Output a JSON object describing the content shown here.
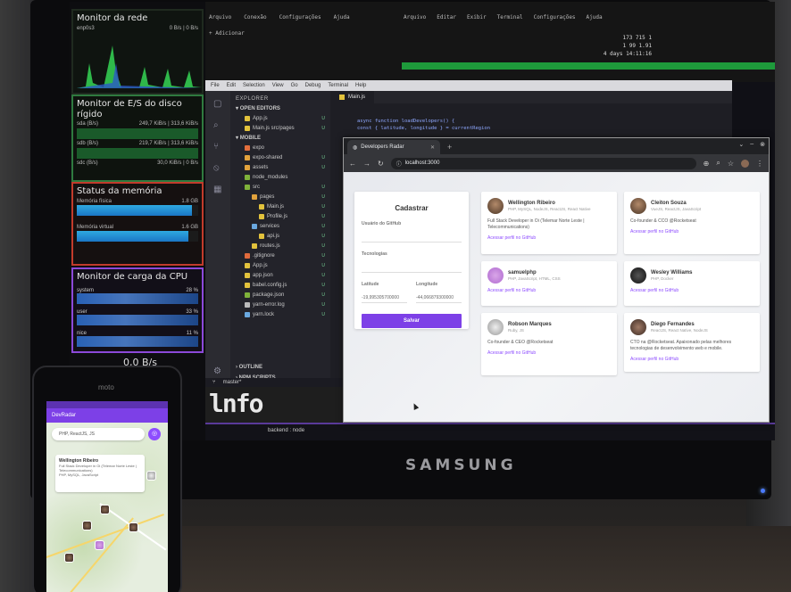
{
  "sysmon": {
    "net_title": "Monitor da rede",
    "net_sub": "enp0s3",
    "net_rate": "0 B/s | 0 B/s",
    "disk_title": "Monitor de E/S do disco rígido",
    "disk_rows": [
      {
        "name": "sda (B/s)",
        "value": "249,7 KiB/s | 313,6 KiB/s"
      },
      {
        "name": "sdb (B/s)",
        "value": "219,7 KiB/s | 313,6 KiB/s"
      },
      {
        "name": "sdc (B/s)",
        "value": "30,0 KiB/s | 0 B/s"
      }
    ],
    "mem_title": "Status da memória",
    "mem_physical_label": "Memória física",
    "mem_physical_value": "1.8 GB",
    "mem_physical_level": 0.95,
    "mem_virtual_label": "Memória virtual",
    "mem_virtual_value": "1.6 GB",
    "mem_virtual_level": 0.92,
    "cpu_title": "Monitor de carga da CPU",
    "cpu_rows": [
      {
        "name": "system",
        "value": "28 %"
      },
      {
        "name": "user",
        "value": "33 %"
      },
      {
        "name": "nice",
        "value": "11 %"
      }
    ],
    "cpu_footer": "0,0 B/s"
  },
  "terminal": {
    "menu": [
      "Arquivo",
      "Editar",
      "Exibir",
      "Terminal",
      "Configurações",
      "Ajuda"
    ],
    "tabs": [
      "Arquivo",
      "Conexão",
      "Configurações",
      "Ajuda"
    ],
    "add_label": "+ Adicionar",
    "stats": [
      "173  715     1",
      "1 99 1.91",
      "4 days  14:11:16"
    ]
  },
  "vscode": {
    "menu": [
      "File",
      "Edit",
      "Selection",
      "View",
      "Go",
      "Debug",
      "Terminal",
      "Help"
    ],
    "explorer_title": "EXPLORER",
    "open_editors": "OPEN EDITORS",
    "project": "MOBILE",
    "open_files": [
      {
        "name": "App.js",
        "badge": "U"
      },
      {
        "name": "Main.js  src/pages",
        "badge": "U"
      }
    ],
    "tree": [
      {
        "name": "expo",
        "badge": "",
        "color": "#e26e3c"
      },
      {
        "name": "expo-shared",
        "badge": "U",
        "color": "#e2a23c"
      },
      {
        "name": "assets",
        "badge": "U",
        "color": "#e2a23c"
      },
      {
        "name": "node_modules",
        "badge": "",
        "color": "#7fb23a"
      },
      {
        "name": "src",
        "badge": "U",
        "color": "#7fb23a"
      },
      {
        "name": "pages",
        "badge": "U",
        "color": "#e2a23c"
      },
      {
        "name": "Main.js",
        "badge": "U",
        "color": "#e2c23c"
      },
      {
        "name": "Profile.js",
        "badge": "U",
        "color": "#e2c23c"
      },
      {
        "name": "services",
        "badge": "U",
        "color": "#6aa8e0"
      },
      {
        "name": "api.js",
        "badge": "U",
        "color": "#e2c23c"
      },
      {
        "name": "routes.js",
        "badge": "U",
        "color": "#e2c23c"
      },
      {
        "name": ".gitignore",
        "badge": "U",
        "color": "#e06a3c"
      },
      {
        "name": "App.js",
        "badge": "U",
        "color": "#e2c23c"
      },
      {
        "name": "app.json",
        "badge": "U",
        "color": "#e2c23c"
      },
      {
        "name": "babel.config.js",
        "badge": "U",
        "color": "#e2c23c"
      },
      {
        "name": "package.json",
        "badge": "U",
        "color": "#7fb23a"
      },
      {
        "name": "yarn-error.log",
        "badge": "U",
        "color": "#bbbbbb"
      },
      {
        "name": "yarn.lock",
        "badge": "U",
        "color": "#6aa8e0"
      }
    ],
    "outline": "OUTLINE",
    "npm_scripts": "NPM SCRIPTS",
    "tab": "Main.js",
    "code": [
      "async function loadDevelopers() {",
      "  const { latitude, longitude } = currentRegion"
    ],
    "branch": "master*",
    "bottom_term": "backend : node"
  },
  "browser": {
    "tab_title": "Developers Radar",
    "url": "localhost:3000"
  },
  "devradar": {
    "form": {
      "title": "Cadastrar",
      "github_label": "Usuário do GitHub",
      "techs_label": "Tecnologias",
      "lat_label": "Latitude",
      "lat_value": "-19,995305700000",
      "lon_label": "Longitude",
      "lon_value": "-44,066879300000",
      "save": "Salvar"
    },
    "devs": [
      {
        "name": "Wellington Ribeiro",
        "techs": "PHP, MySQL, NodeJS, ReactJS, React Native",
        "bio": "Full Stack Developer in Oi (Telemar Norte Leste | Telecommunications)",
        "link": "Acessar perfil no GitHub"
      },
      {
        "name": "Cleiton Souza",
        "techs": "VueJS, ReactJS, JavaScript",
        "bio": "Co-founder & CCO @Rocketseat",
        "link": "Acessar perfil no GitHub"
      },
      {
        "name": "samuelphp",
        "techs": "PHP, JavaScript, HTML, CSS",
        "bio": "",
        "link": "Acessar perfil no GitHub"
      },
      {
        "name": "Wesley Williams",
        "techs": "PHP, Docker",
        "bio": "",
        "link": "Acessar perfil no GitHub"
      },
      {
        "name": "Robson Marques",
        "techs": "Ruby, JS",
        "bio": "Co-founder & CEO @Rocketseat",
        "link": "Acessar perfil no GitHub"
      },
      {
        "name": "Diego Fernandes",
        "techs": "ReactJS, React Native, NodeJS",
        "bio": "CTO na @Rocketseat. Apaixonado pelas melhores tecnologias de desenvolvimento web e mobile.",
        "link": "Acessar perfil no GitHub"
      }
    ]
  },
  "monitor_brand": "SAMSUNG",
  "phone": {
    "brand": "moto",
    "app_title": "DevRadar",
    "search_value": "PHP, ReactJS, JS",
    "callout_name": "Wellington Ribeiro",
    "callout_bio": "Full Stack Developer in Oi (Telemar Norte Leste | Telecommunications)",
    "callout_techs": "PHP, MySQL, JavaScript"
  },
  "colors": {
    "accent": "#7d40e7",
    "link": "#8e4dff"
  }
}
